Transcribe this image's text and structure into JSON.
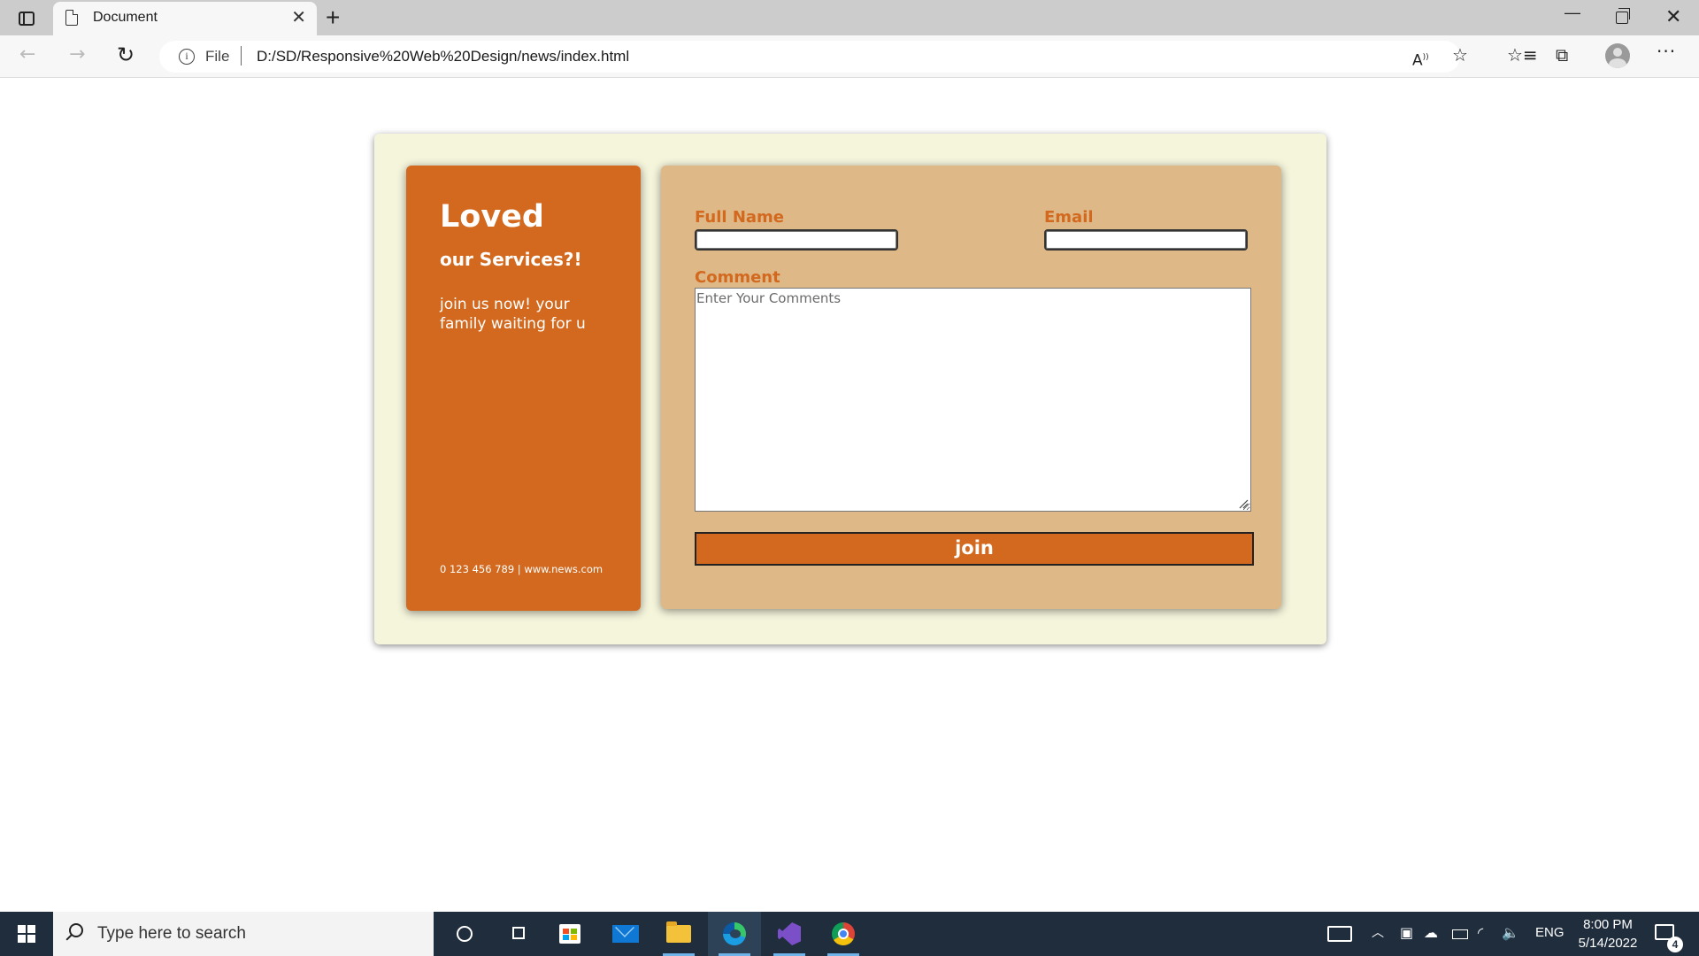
{
  "browser": {
    "tab_title": "Document",
    "close_tab_glyph": "✕",
    "new_tab_glyph": "+",
    "url_scheme_label": "File",
    "url": "D:/SD/Responsive%20Web%20Design/news/index.html",
    "icons": [
      "tab-actions-icon",
      "page-icon",
      "back-icon",
      "forward-icon",
      "reload-icon",
      "info-icon",
      "read-aloud-icon",
      "add-favorite-icon",
      "favorites-icon",
      "collections-icon",
      "profile-avatar",
      "more-icon"
    ]
  },
  "page": {
    "left_panel": {
      "title": "Loved",
      "subtitle": "our Services?!",
      "text": "join us now! your family waiting for u",
      "footer": "0 123 456 789 | www.news.com"
    },
    "form": {
      "full_name_label": "Full Name",
      "full_name_value": "",
      "email_label": "Email",
      "email_value": "",
      "comment_label": "Comment",
      "comment_placeholder": "Enter Your Comments",
      "submit_label": "join"
    },
    "colors": {
      "outer_card": "#f5f5dc",
      "panel_accent": "#d2691e",
      "form_background": "#deb887"
    }
  },
  "taskbar": {
    "search_placeholder": "Type here to search",
    "apps": [
      "cortana",
      "task-view",
      "microsoft-store",
      "mail",
      "file-explorer",
      "edge",
      "visual-studio",
      "chrome"
    ],
    "language": "ENG",
    "time": "8:00 PM",
    "date": "5/14/2022",
    "notification_count": "4"
  }
}
